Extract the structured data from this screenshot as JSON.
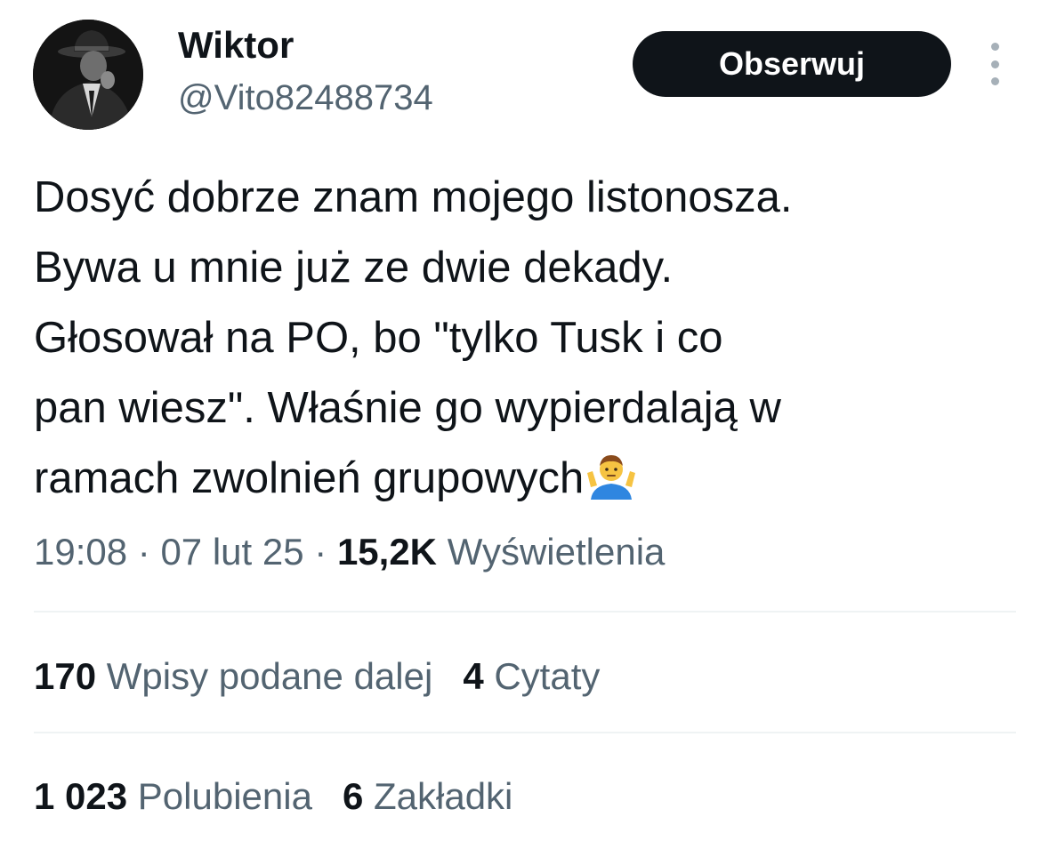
{
  "author": {
    "display_name": "Wiktor",
    "handle": "@Vito82488734"
  },
  "follow_button": {
    "label": "Obserwuj"
  },
  "tweet": {
    "text_lines": [
      "Dosyć dobrze znam mojego listonosza.",
      "Bywa u mnie już ze dwie dekady.",
      "Głosował na PO, bo \"tylko Tusk i co",
      "pan wiesz\". Właśnie go wypierdalają w",
      "ramach zwolnień grupowych"
    ],
    "emoji": "person-shrugging-emoji"
  },
  "meta": {
    "time": "19:08",
    "sep1": "·",
    "date": "07 lut 25",
    "sep2": "·",
    "views_count": "15,2K",
    "views_label": "Wyświetlenia"
  },
  "stats_row1": [
    {
      "count": "170",
      "label": "Wpisy podane dalej"
    },
    {
      "count": "4",
      "label": "Cytaty"
    }
  ],
  "stats_row2": [
    {
      "count": "1 023",
      "label": "Polubienia"
    },
    {
      "count": "6",
      "label": "Zakładki"
    }
  ],
  "colors": {
    "text_primary": "#0f1419",
    "text_secondary": "#536471",
    "button_bg": "#0f1419",
    "divider": "#eff3f4"
  }
}
